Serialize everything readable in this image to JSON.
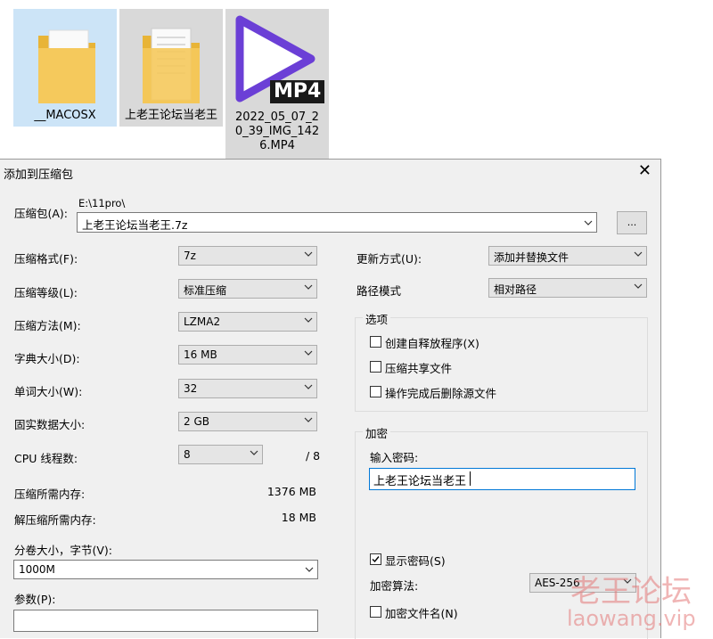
{
  "desktop": {
    "icons": [
      {
        "label": "__MACOSX"
      },
      {
        "label": "上老王论坛当老王"
      },
      {
        "label": "2022_05_07_20_39_IMG_1426.MP4",
        "badge": "MP4"
      }
    ]
  },
  "dialog": {
    "title": "添加到压缩包",
    "archive": {
      "label": "压缩包(A):",
      "path": "E:\\11pro\\",
      "filename": "上老王论坛当老王.7z",
      "browse_label": "..."
    },
    "left": {
      "format": {
        "label": "压缩格式(F):",
        "value": "7z"
      },
      "level": {
        "label": "压缩等级(L):",
        "value": "标准压缩"
      },
      "method": {
        "label": "压缩方法(M):",
        "value": "LZMA2"
      },
      "dict": {
        "label": "字典大小(D):",
        "value": "16 MB"
      },
      "word": {
        "label": "单词大小(W):",
        "value": "32"
      },
      "solid": {
        "label": "固实数据大小:",
        "value": "2 GB"
      },
      "threads": {
        "label": "CPU 线程数:",
        "value": "8",
        "max": "/ 8"
      },
      "mem_compress": {
        "label": "压缩所需内存:",
        "value": "1376 MB"
      },
      "mem_decompress": {
        "label": "解压缩所需内存:",
        "value": "18 MB"
      },
      "volume": {
        "label": "分卷大小，字节(V):",
        "value": "1000M"
      },
      "params": {
        "label": "参数(P):",
        "value": ""
      }
    },
    "right": {
      "update": {
        "label": "更新方式(U):",
        "value": "添加并替换文件"
      },
      "pathmode": {
        "label": "路径模式",
        "value": "相对路径"
      },
      "options": {
        "title": "选项",
        "sfx": {
          "label": "创建自释放程序(X)",
          "checked": false
        },
        "shared": {
          "label": "压缩共享文件",
          "checked": false
        },
        "delete": {
          "label": "操作完成后删除源文件",
          "checked": false
        }
      },
      "encryption": {
        "title": "加密",
        "password_label": "输入密码:",
        "password_value": "上老王论坛当老王",
        "show_password": {
          "label": "显示密码(S)",
          "checked": true
        },
        "method_label": "加密算法:",
        "method_value": "AES-256",
        "encrypt_names": {
          "label": "加密文件名(N)",
          "checked": false
        }
      }
    }
  },
  "watermark": {
    "line1": "老王论坛",
    "line2": "laowang.vip"
  }
}
